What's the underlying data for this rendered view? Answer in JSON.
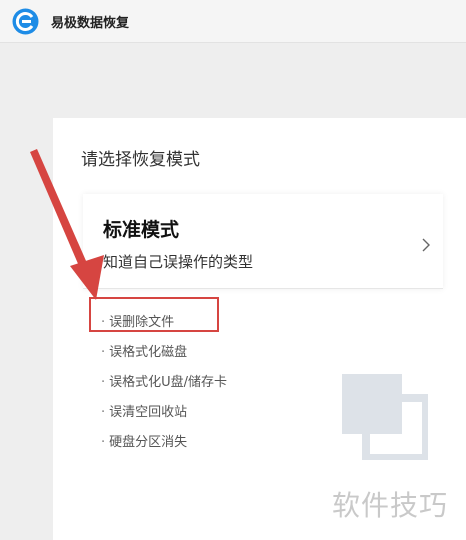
{
  "app": {
    "title": "易极数据恢复",
    "logo_icon": "refresh-e-logo-icon",
    "logo_color": "#1e8ce6"
  },
  "prompt": "请选择恢复模式",
  "mode": {
    "title": "标准模式",
    "description": "知道自己误操作的类型",
    "chevron_icon": "chevron-right-icon"
  },
  "scenarios": [
    {
      "label": "误删除文件",
      "highlighted": true
    },
    {
      "label": "误格式化磁盘",
      "highlighted": false
    },
    {
      "label": "误格式化U盘/储存卡",
      "highlighted": false
    },
    {
      "label": "误清空回收站",
      "highlighted": false
    },
    {
      "label": "硬盘分区消失",
      "highlighted": false
    }
  ],
  "annotation": {
    "arrow_color": "#d64541",
    "box_color": "#d64541"
  },
  "watermark": {
    "text": "软件技巧"
  }
}
